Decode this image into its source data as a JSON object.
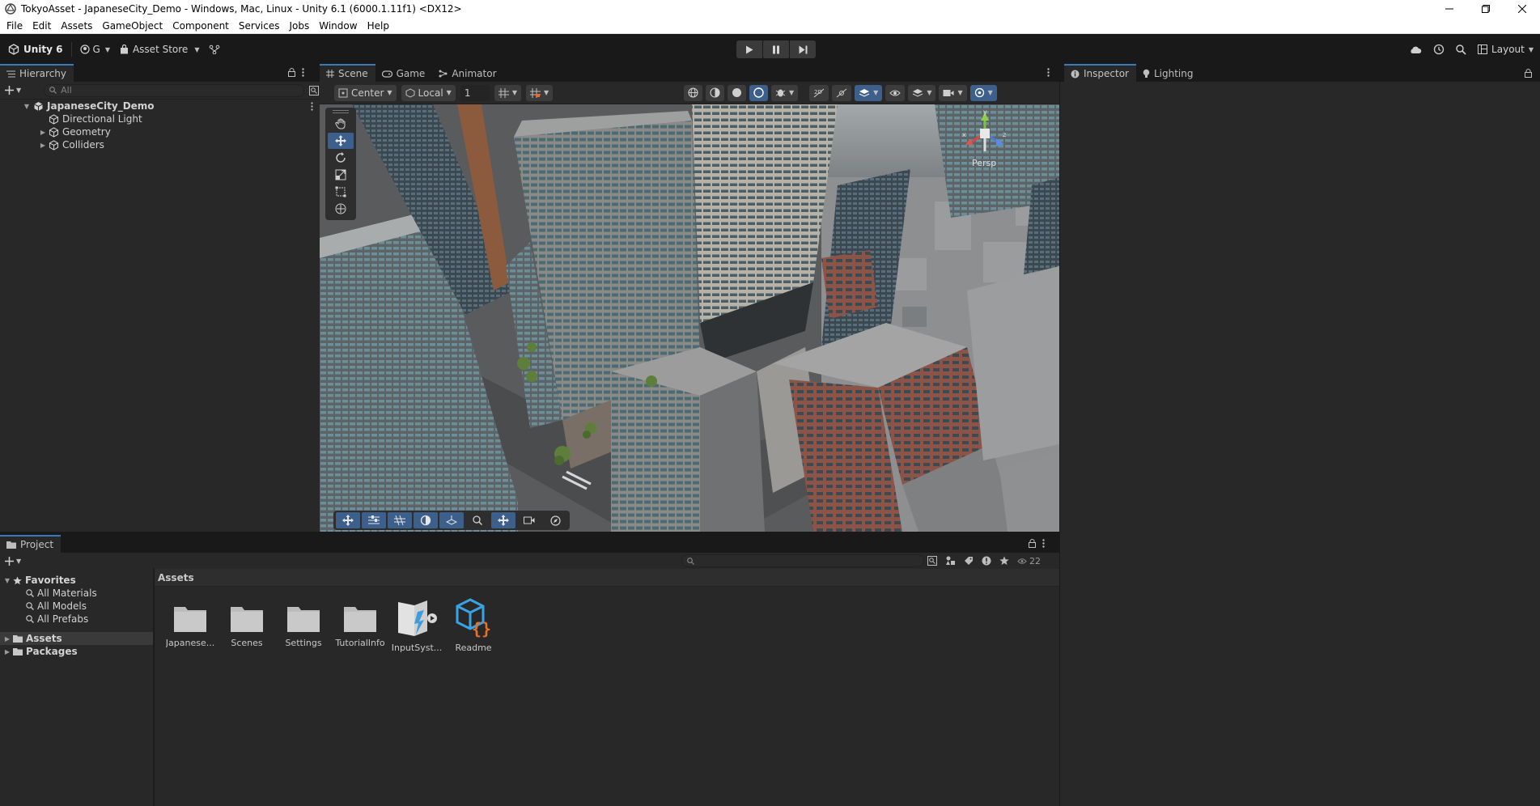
{
  "window": {
    "title": "TokyoAsset - JapaneseCity_Demo - Windows, Mac, Linux - Unity 6.1 (6000.1.11f1) <DX12>",
    "icons": [
      "unity-icon",
      "minimize-icon",
      "maximize-icon",
      "close-icon"
    ]
  },
  "menu": [
    "File",
    "Edit",
    "Assets",
    "GameObject",
    "Component",
    "Services",
    "Jobs",
    "Window",
    "Help"
  ],
  "toolbar": {
    "unity_label": "Unity 6",
    "account_label": "G",
    "asset_store_label": "Asset Store",
    "layout_label": "Layout"
  },
  "hierarchy": {
    "tab": "Hierarchy",
    "search_placeholder": "All",
    "scene_name": "JapaneseCity_Demo",
    "items": [
      {
        "label": "Directional Light",
        "expandable": false
      },
      {
        "label": "Geometry",
        "expandable": true
      },
      {
        "label": "Colliders",
        "expandable": true
      }
    ]
  },
  "scene": {
    "tabs": [
      "Scene",
      "Game",
      "Animator"
    ],
    "pivot_label": "Center",
    "space_label": "Local",
    "grid_snap_value": "1",
    "gizmo_label": "Persp",
    "gizmo_axes": [
      "y",
      "x",
      "z"
    ]
  },
  "inspector": {
    "tabs": [
      "Inspector",
      "Lighting"
    ]
  },
  "project": {
    "tab": "Project",
    "visible_count": "22",
    "favorites_label": "Favorites",
    "favorites": [
      "All Materials",
      "All Models",
      "All Prefabs"
    ],
    "roots": [
      "Assets",
      "Packages"
    ],
    "breadcrumb": "Assets",
    "assets": [
      {
        "label": "Japanese...",
        "type": "folder"
      },
      {
        "label": "Scenes",
        "type": "folder"
      },
      {
        "label": "Settings",
        "type": "folder"
      },
      {
        "label": "TutorialInfo",
        "type": "folder"
      },
      {
        "label": "InputSyst...",
        "type": "input-actions"
      },
      {
        "label": "Readme",
        "type": "readme"
      }
    ]
  },
  "colors": {
    "accent": "#3a79bb",
    "panel": "#282828",
    "toolbar": "#191919",
    "active_tool": "#3d5f8c"
  }
}
